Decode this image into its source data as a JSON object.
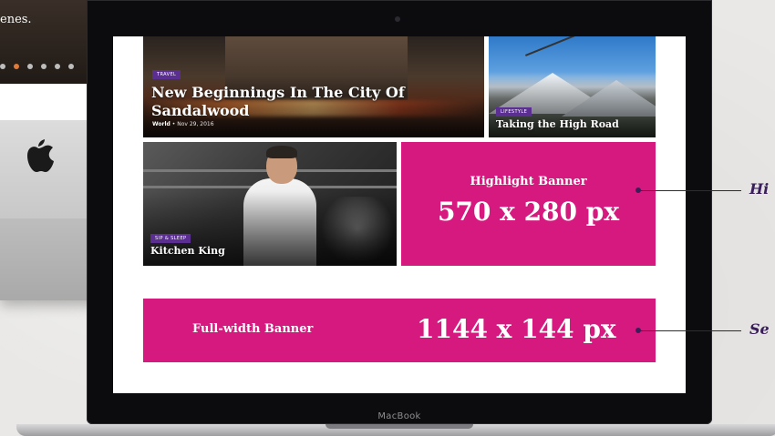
{
  "background_device": {
    "partial_text": "enes.",
    "carousel_dots": [
      false,
      true,
      false,
      false,
      false,
      false
    ]
  },
  "laptop": {
    "brand": "MacBook"
  },
  "screen": {
    "tiles": [
      {
        "category": "TRAVEL",
        "title": "New Beginnings In The City Of Sandalwood",
        "meta_section": "World",
        "meta_date": "Nov 29, 2016"
      },
      {
        "category": "LIFESTYLE",
        "title": "Taking the High Road"
      },
      {
        "category": "SIP & SLEEP",
        "title": "Kitchen King"
      }
    ],
    "highlight_banner": {
      "label": "Highlight Banner",
      "size": "570 x 280 px"
    },
    "full_width_banner": {
      "label": "Full-width Banner",
      "size": "1144 x 144 px"
    }
  },
  "callouts": [
    {
      "text": "Hi"
    },
    {
      "text": "Se"
    }
  ],
  "colors": {
    "banner_magenta": "#d6197e",
    "badge_purple": "#5b2e91",
    "callout_purple": "#3a1e5a",
    "carousel_active": "#e07a3a"
  }
}
